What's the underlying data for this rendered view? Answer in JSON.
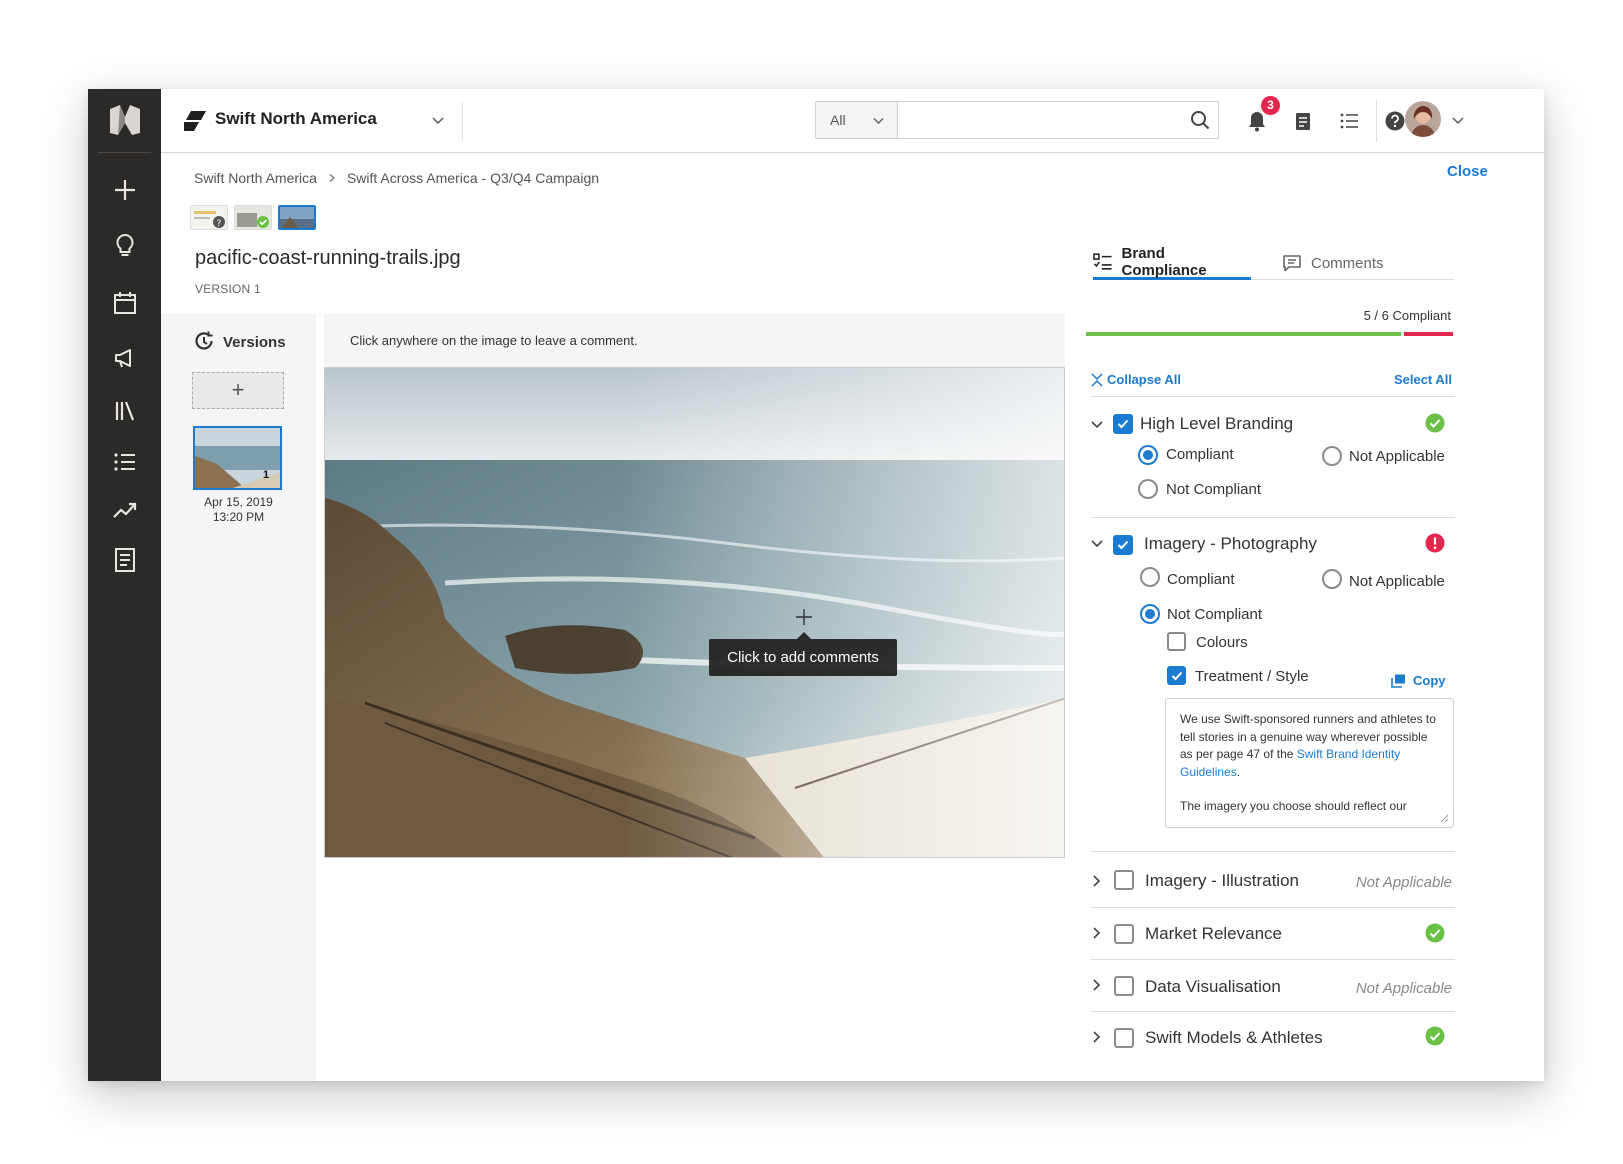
{
  "topbar": {
    "workspace_name": "Swift North America",
    "search_scope": "All",
    "search_placeholder": "",
    "notification_count": "3"
  },
  "breadcrumb": {
    "items": [
      "Swift North America",
      "Swift Across America - Q3/Q4 Campaign"
    ]
  },
  "close_label": "Close",
  "asset": {
    "title": "pacific-coast-running-trails.jpg",
    "version": "VERSION 1"
  },
  "versions": {
    "label": "Versions",
    "add_label": "+",
    "items": [
      {
        "number": "1",
        "date": "Apr 15, 2019",
        "time": "13:20 PM"
      }
    ]
  },
  "canvas": {
    "hint": "Click anywhere on the image to leave a comment.",
    "tooltip": "Click to add comments"
  },
  "panel": {
    "tabs": [
      {
        "label": "Brand Compliance",
        "active": true
      },
      {
        "label": "Comments",
        "active": false
      }
    ],
    "compliance_text": "5 / 6 Compliant",
    "compliance_fraction": 0.857,
    "collapse_all": "Collapse All",
    "select_all": "Select All",
    "categories": [
      {
        "label": "High Level Branding",
        "status": "compliant",
        "options": {
          "compliant": "Compliant",
          "not_applicable": "Not Applicable",
          "not_compliant": "Not Compliant"
        }
      },
      {
        "label": "Imagery - Photography",
        "status": "not-compliant",
        "options": {
          "compliant": "Compliant",
          "not_applicable": "Not Applicable",
          "not_compliant": "Not Compliant"
        },
        "subitems": [
          {
            "label": "Colours",
            "checked": false
          },
          {
            "label": "Treatment / Style",
            "checked": true
          }
        ],
        "copy_label": "Copy",
        "note": {
          "text_before_link": "We use Swift-sponsored runners and athletes to tell stories in a genuine way wherever possible as per page 47 of the ",
          "link_text": "Swift Brand Identity Guidelines",
          "text_after_link": ".",
          "second_paragraph": "The imagery you choose should reflect our"
        }
      },
      {
        "label": "Imagery - Illustration",
        "status_text": "Not Applicable"
      },
      {
        "label": "Market Relevance",
        "status": "compliant"
      },
      {
        "label": "Data Visualisation",
        "status_text": "Not Applicable"
      },
      {
        "label": "Swift Models & Athletes",
        "status": "compliant"
      }
    ]
  },
  "colors": {
    "accent": "#1b7bd1",
    "success": "#6abf45",
    "danger": "#e2264d",
    "rail": "#2c2a28"
  }
}
